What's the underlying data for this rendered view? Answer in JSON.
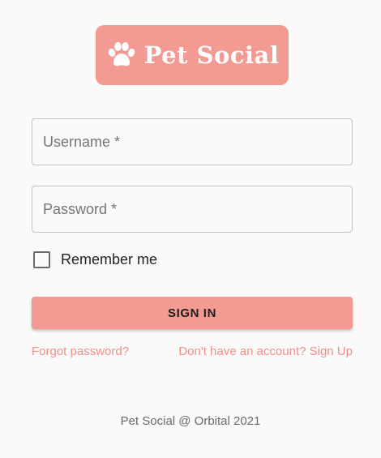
{
  "brand": {
    "name": "Pet Social",
    "icon": "paw-icon",
    "color": "#f39a93"
  },
  "form": {
    "username_label": "Username *",
    "password_label": "Password *",
    "remember_label": "Remember me",
    "remember_checked": false,
    "signin_label": "SIGN IN"
  },
  "links": {
    "forgot": "Forgot password?",
    "signup": "Don't have an account? Sign Up",
    "color": "#ef8f86"
  },
  "footer": {
    "text": "Pet Social @ Orbital 2021"
  }
}
